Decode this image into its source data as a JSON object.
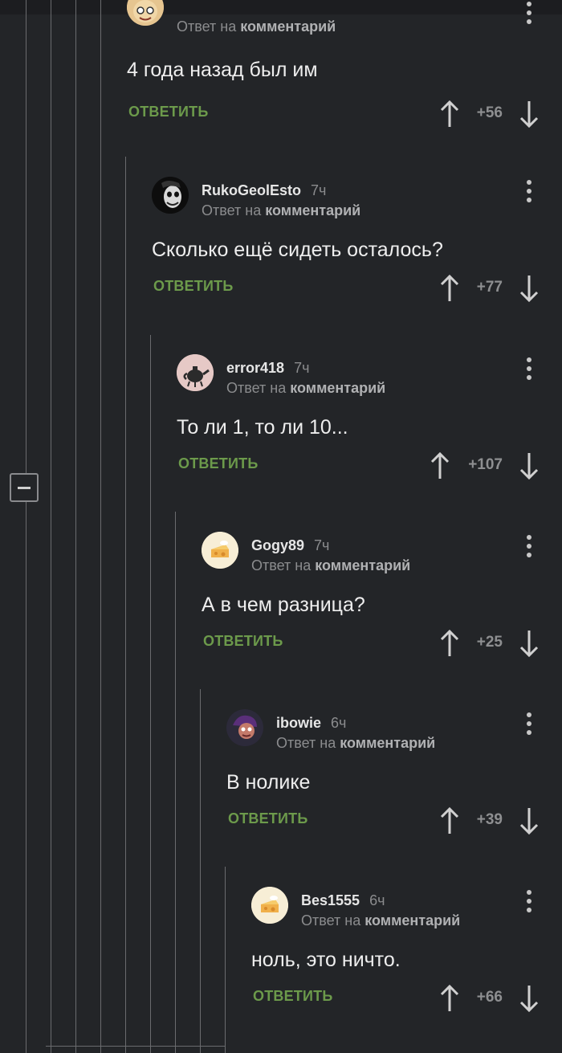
{
  "reply_button_label": "ОТВЕТИТЬ",
  "reply_prefix": "Ответ на",
  "reply_target": "комментарий",
  "colors": {
    "background": "#232528",
    "reply_green": "#6c9a4b",
    "muted": "#8b8c8e",
    "thread_line": "#6a6b6e"
  },
  "comments": [
    {
      "username": "",
      "time": "",
      "text": "4 года назад был им",
      "score": "+56",
      "avatar_icon": "cartoon-face-avatar"
    },
    {
      "username": "RukoGeolEsto",
      "time": "7ч",
      "text": "Сколько ещё сидеть осталось?",
      "score": "+77",
      "avatar_icon": "joker-avatar"
    },
    {
      "username": "error418",
      "time": "7ч",
      "text": "То ли 1, то ли 10...",
      "score": "+107",
      "avatar_icon": "teapot-avatar"
    },
    {
      "username": "Gogy89",
      "time": "7ч",
      "text": "А в чем разница?",
      "score": "+25",
      "avatar_icon": "default-cheese-avatar"
    },
    {
      "username": "ibowie",
      "time": "6ч",
      "text": "В нолике",
      "score": "+39",
      "avatar_icon": "cartoon-character-avatar"
    },
    {
      "username": "Bes1555",
      "time": "6ч",
      "text": "ноль, это ничто.",
      "score": "+66",
      "avatar_icon": "default-cheese-avatar"
    }
  ]
}
